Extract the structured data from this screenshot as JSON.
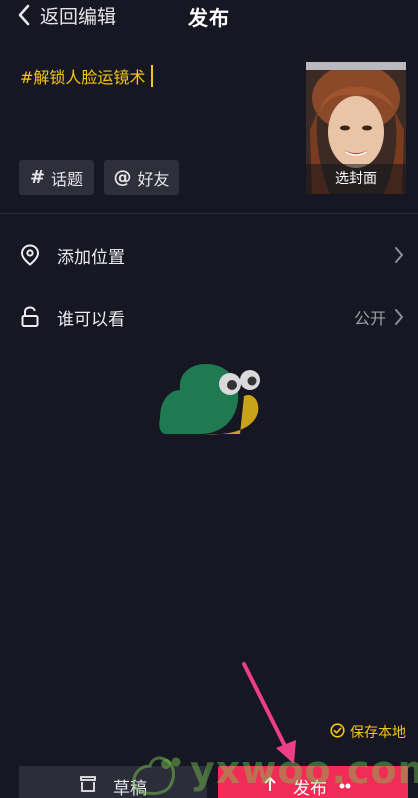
{
  "header": {
    "back_label": "返回编辑",
    "title": "发布"
  },
  "caption": {
    "text": "#解锁人脸运镜术"
  },
  "cover": {
    "label": "选封面"
  },
  "chips": {
    "topic_symbol": "#",
    "topic_label": "话题",
    "friend_symbol": "@",
    "friend_label": "好友"
  },
  "rows": {
    "location_label": "添加位置",
    "privacy_label": "谁可以看",
    "privacy_value": "公开"
  },
  "save_local": {
    "label": "保存本地"
  },
  "buttons": {
    "draft_label": "草稿",
    "publish_label": "发布"
  },
  "watermark": {
    "text": "yxwoo.com"
  },
  "colors": {
    "background": "#161722",
    "accent_yellow": "#f5c518",
    "publish_red": "#f12c56",
    "chip_bg": "#2e2f3a",
    "annotation_arrow": "#ec3f86"
  },
  "icons": {
    "back": "chevron-left-icon",
    "location": "location-pin-icon",
    "privacy": "unlock-icon",
    "chevron": "chevron-right-icon",
    "save_check": "check-circle-icon",
    "draft": "draft-box-icon",
    "publish": "upload-sparkle-icon"
  }
}
